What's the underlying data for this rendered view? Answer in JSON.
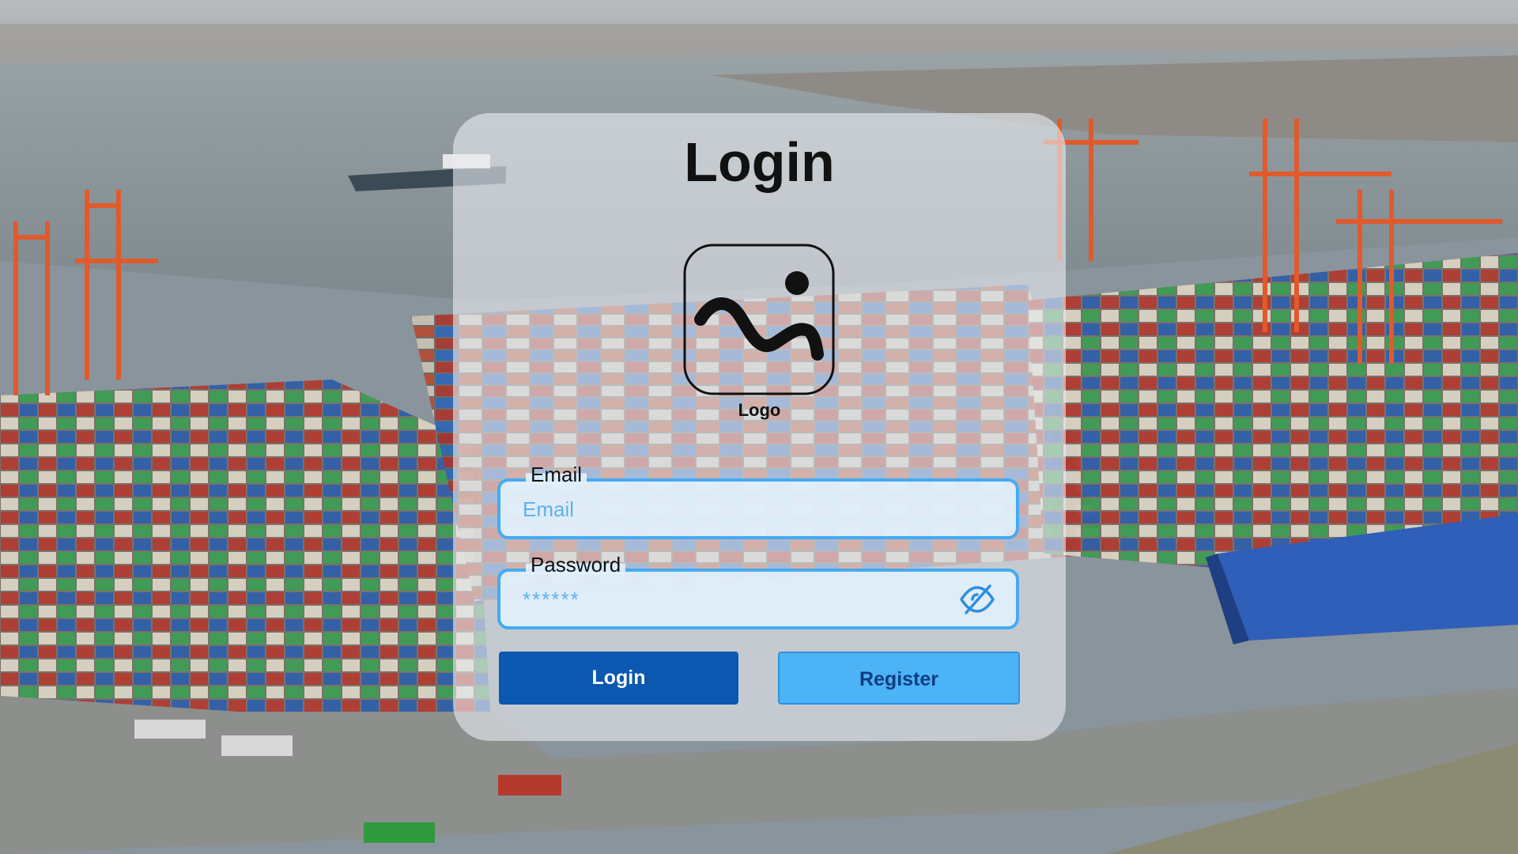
{
  "page": {
    "title": "Login"
  },
  "logo": {
    "icon": "image-placeholder-icon",
    "label": "Logo"
  },
  "email": {
    "label": "Email",
    "placeholder": "Email",
    "value": ""
  },
  "password": {
    "label": "Password",
    "placeholder": "******",
    "value": "",
    "toggle_icon": "eye-off-icon"
  },
  "buttons": {
    "login_label": "Login",
    "register_label": "Register"
  },
  "colors": {
    "primary": "#0a58b0",
    "secondary": "#4db3f7",
    "field_border": "#45aaf2",
    "placeholder": "#5fb1ea"
  }
}
